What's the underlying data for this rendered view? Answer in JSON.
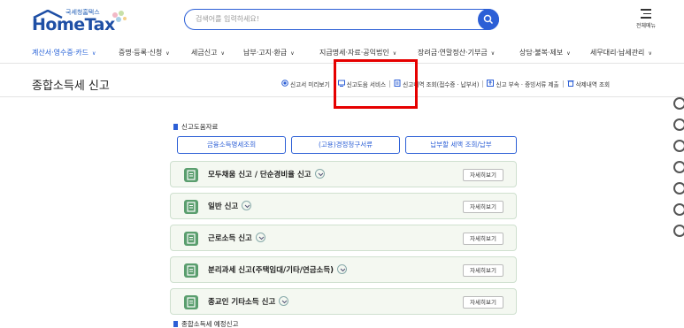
{
  "header": {
    "logo_sub": "국세청홈택스",
    "logo_main": "HomeTax",
    "search_placeholder": "검색어를 입력하세요!",
    "menu_label": "전체메뉴"
  },
  "gnb": {
    "items": [
      {
        "label": "계산서·영수증·카드"
      },
      {
        "label": "증명·등록·신청"
      },
      {
        "label": "세금신고"
      },
      {
        "label": "납부·고지·환급"
      },
      {
        "label": "지급명세·자료·공익법인"
      },
      {
        "label": "장려금·연말정산·기부금"
      },
      {
        "label": "상담·불복·제보"
      },
      {
        "label": "세무대리·납세관리"
      }
    ],
    "active_color": "#1e5bd6"
  },
  "page": {
    "title": "종합소득세 신고"
  },
  "toolbar": {
    "preview": "신고서 미리보기",
    "help_service": "신고도움 서비스",
    "history": "신고내역 조회(접수증 · 납부서)",
    "attach": "신고 부속 · 증빙서류 제출",
    "delete_history": "삭제내역 조회"
  },
  "help_section": {
    "title": "신고도움자료",
    "buttons": [
      {
        "label": "금융소득명세조회"
      },
      {
        "label": "(고용)경정청구서류"
      },
      {
        "label": "납부할 세액 조회/납부"
      }
    ]
  },
  "filing_cards": [
    {
      "label": "모두채움 신고 / 단순경비율 신고",
      "detail": "자세히보기"
    },
    {
      "label": "일반 신고",
      "detail": "자세히보기"
    },
    {
      "label": "근로소득 신고",
      "detail": "자세히보기"
    },
    {
      "label": "분리과세 신고(주택임대/기타/연금소득)",
      "detail": "자세히보기"
    },
    {
      "label": "종교인 기타소득 신고",
      "detail": "자세히보기"
    }
  ],
  "next_section": {
    "title": "종합소득세 예정신고"
  },
  "colors": {
    "accent": "#2c5fd6",
    "card_bg": "#f4f8f1",
    "card_icon": "#5a9e6e",
    "highlight": "#e60000"
  }
}
